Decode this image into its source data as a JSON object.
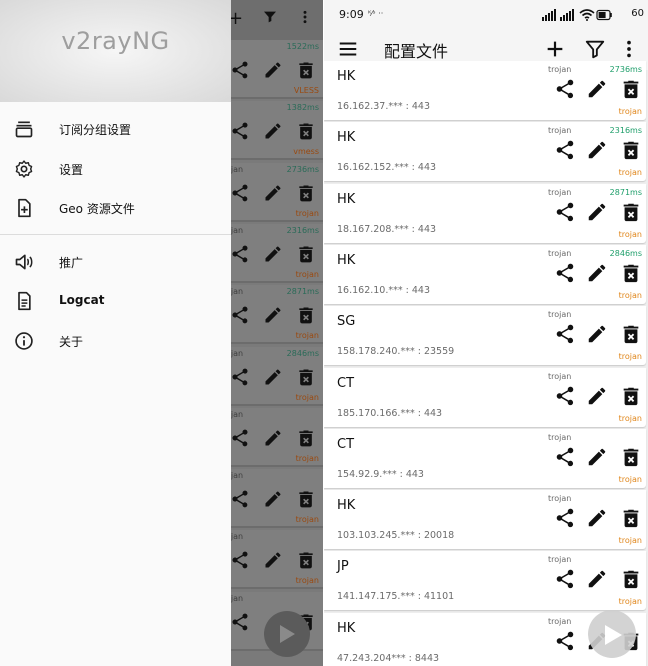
{
  "drawer": {
    "title": "v2rayNG",
    "items": [
      {
        "label": "订阅分组设置",
        "icon": "subscription-icon"
      },
      {
        "label": "设置",
        "icon": "gear-icon"
      },
      {
        "label": "Geo 资源文件",
        "icon": "file-add-icon"
      },
      {
        "label": "推广",
        "icon": "megaphone-icon"
      },
      {
        "label": "Logcat",
        "icon": "log-icon"
      },
      {
        "label": "关于",
        "icon": "info-icon"
      }
    ]
  },
  "dim_list": [
    {
      "type": "",
      "delay": "1522ms",
      "proto": "VLESS"
    },
    {
      "type": "",
      "delay": "1382ms",
      "proto": "vmess"
    },
    {
      "type": "ojan",
      "delay": "2736ms",
      "proto": "trojan"
    },
    {
      "type": "ojan",
      "delay": "2316ms",
      "proto": "trojan"
    },
    {
      "type": "ojan",
      "delay": "2871ms",
      "proto": "trojan"
    },
    {
      "type": "ojan",
      "delay": "2846ms",
      "proto": "trojan"
    },
    {
      "type": "ojan",
      "delay": "",
      "proto": "trojan"
    },
    {
      "type": "ojan",
      "delay": "",
      "proto": "trojan"
    },
    {
      "type": "ojan",
      "delay": "",
      "proto": "trojan"
    },
    {
      "type": "ojan",
      "delay": "",
      "proto": ""
    }
  ],
  "status_bar": {
    "time": "9:09",
    "notification": "ᴷ⁄ˢ ··",
    "battery": "60"
  },
  "toolbar": {
    "title": "配置文件",
    "icons": [
      "menu-icon",
      "add-icon",
      "filter-icon",
      "more-vert-icon"
    ]
  },
  "servers": [
    {
      "name": "HK",
      "address": "16.162.37.*** : 443",
      "type": "trojan",
      "delay": "2736ms",
      "proto": "trojan"
    },
    {
      "name": "HK",
      "address": "16.162.152.*** : 443",
      "type": "trojan",
      "delay": "2316ms",
      "proto": "trojan"
    },
    {
      "name": "HK",
      "address": "18.167.208.*** : 443",
      "type": "trojan",
      "delay": "2871ms",
      "proto": "trojan"
    },
    {
      "name": "HK",
      "address": "16.162.10.*** : 443",
      "type": "trojan",
      "delay": "2846ms",
      "proto": "trojan"
    },
    {
      "name": "SG",
      "address": "158.178.240.*** : 23559",
      "type": "trojan",
      "delay": "",
      "proto": "trojan"
    },
    {
      "name": "CT",
      "address": "185.170.166.*** : 443",
      "type": "trojan",
      "delay": "",
      "proto": "trojan"
    },
    {
      "name": "CT",
      "address": "154.92.9.*** : 443",
      "type": "trojan",
      "delay": "",
      "proto": "trojan"
    },
    {
      "name": "HK",
      "address": "103.103.245.*** : 20018",
      "type": "trojan",
      "delay": "",
      "proto": "trojan"
    },
    {
      "name": "JP",
      "address": "141.147.175.*** : 41101",
      "type": "trojan",
      "delay": "",
      "proto": "trojan"
    },
    {
      "name": "HK",
      "address": "47.243.204*** : 8443",
      "type": "trojan",
      "delay": "",
      "proto": ""
    }
  ],
  "colors": {
    "delay": "#1e9e6a",
    "protocol": "#e0861b",
    "drawer_bg": "#fafafa",
    "scrim": "#7a7a7a"
  }
}
